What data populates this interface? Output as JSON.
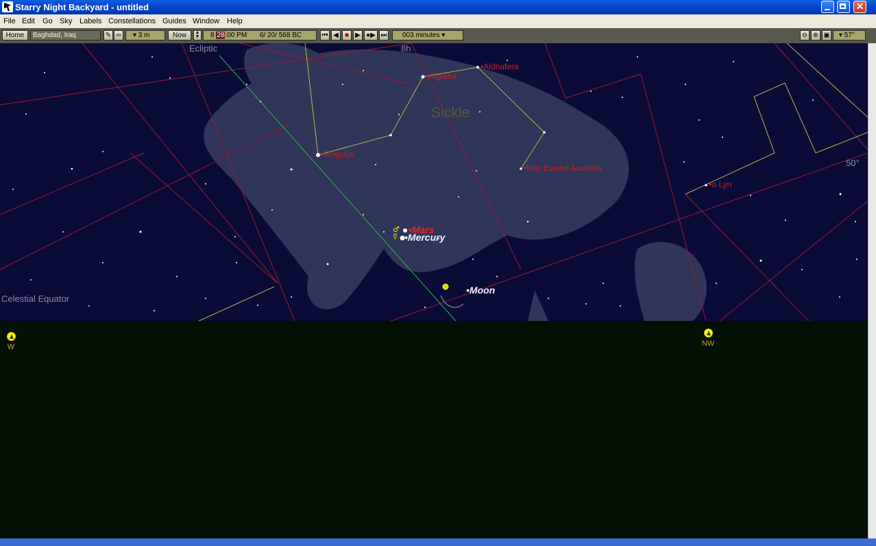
{
  "window": {
    "title": "Starry Night Backyard - untitled"
  },
  "menu": [
    "File",
    "Edit",
    "Go",
    "Sky",
    "Labels",
    "Constellations",
    "Guides",
    "Window",
    "Help"
  ],
  "toolbar": {
    "home_label": "Home",
    "location": "Baghdad, Iraq",
    "time_step": "▾ 3 m",
    "now_label": "Now",
    "time_hour": "8",
    "time_minute": "28",
    "time_rest": ":00 PM",
    "date": "6/ 20/  568 BC",
    "rate": "003 minutes ▾",
    "fov": "▾ 57°"
  },
  "sky": {
    "ecliptic_label": "Ecliptic",
    "celestial_equator_label": "Celestial Equator",
    "ra_label": "8h",
    "dec_label": "50°",
    "asterism_label": "Sickle",
    "stars": {
      "regulus": "Regulus",
      "algieba": "Algieba",
      "aldhafera": "Aldhafera",
      "ras_elased": "Ras Elased Australis",
      "alpha_lyn": "α Lyn"
    },
    "planets": {
      "mars": "Mars",
      "mercury": "Mercury",
      "moon": "Moon"
    }
  },
  "horizon": {
    "west": "W",
    "northwest": "NW"
  },
  "colors": {
    "sky": "#0b0b38",
    "ground": "#021103",
    "ecliptic": "#2bbd3a",
    "boundary": "#9c1c2a",
    "constellation_line": "#b8b84a",
    "star_label": "#c12323"
  }
}
